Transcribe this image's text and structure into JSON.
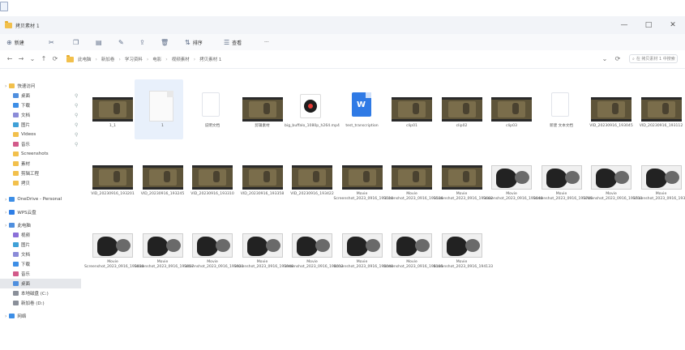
{
  "window": {
    "tab_title": "拷贝素材 1",
    "controls": [
      "—",
      "□",
      "✕"
    ]
  },
  "toolbar": {
    "new_label": "新建",
    "sort_label": "排序",
    "view_label": "查看",
    "more": "···"
  },
  "address": {
    "crumbs": [
      "此电脑",
      "新加卷",
      "学习资料",
      "电影",
      "视频素材",
      "拷贝素材 1"
    ],
    "search_placeholder": "在 拷贝素材 1 中搜索"
  },
  "sidebar": {
    "items": [
      {
        "label": "快速访问",
        "color": "#f2c04c",
        "indent": 6
      },
      {
        "label": "桌面",
        "color": "#4f8fde",
        "indent": 16
      },
      {
        "label": "下载",
        "color": "#3d8ee6",
        "indent": 16
      },
      {
        "label": "文档",
        "color": "#8b8bd8",
        "indent": 16
      },
      {
        "label": "图片",
        "color": "#3fa0d7",
        "indent": 16
      },
      {
        "label": "Videos",
        "color": "#f2c04c",
        "indent": 16
      },
      {
        "label": "音乐",
        "color": "#d25a8a",
        "indent": 16
      },
      {
        "label": "Screenshots",
        "color": "#f2c04c",
        "indent": 16
      },
      {
        "label": "素材",
        "color": "#f2c04c",
        "indent": 16
      },
      {
        "label": "剪辑工程",
        "color": "#f2c04c",
        "indent": 16
      },
      {
        "label": "拷贝",
        "color": "#f2c04c",
        "indent": 16
      },
      {
        "label": "OneDrive - Personal",
        "color": "#3d8ee6",
        "indent": 6
      },
      {
        "label": "WPS云盘",
        "color": "#2e7ee6",
        "indent": 6
      },
      {
        "label": "此电脑",
        "color": "#4f8fde",
        "indent": 6
      },
      {
        "label": "视频",
        "color": "#8b6fd8",
        "indent": 16
      },
      {
        "label": "图片",
        "color": "#3fa0d7",
        "indent": 16
      },
      {
        "label": "文档",
        "color": "#8b8bd8",
        "indent": 16
      },
      {
        "label": "下载",
        "color": "#3d8ee6",
        "indent": 16
      },
      {
        "label": "音乐",
        "color": "#d25a8a",
        "indent": 16
      },
      {
        "label": "桌面",
        "color": "#4f8fde",
        "indent": 16
      },
      {
        "label": "本地磁盘 (C:)",
        "color": "#8a8f99",
        "indent": 16
      },
      {
        "label": "新加卷 (D:)",
        "color": "#8a8f99",
        "indent": 16
      },
      {
        "label": "网络",
        "color": "#3d8ee6",
        "indent": 6
      }
    ]
  },
  "files": [
    {
      "name": "1_1",
      "type": "film"
    },
    {
      "name": "1",
      "type": "doc",
      "selected": true
    },
    {
      "name": "说明文档",
      "type": "blank"
    },
    {
      "name": "剪辑素材",
      "type": "film"
    },
    {
      "name": "big_buffalo_1080p_h264.mp4",
      "type": "media"
    },
    {
      "name": "test_transcription",
      "type": "word"
    },
    {
      "name": "clip01",
      "type": "film"
    },
    {
      "name": "clip02",
      "type": "film"
    },
    {
      "name": "clip03",
      "type": "film"
    },
    {
      "name": "新建 文本文档",
      "type": "blank"
    },
    {
      "name": "VID_20230916_193045",
      "type": "film"
    },
    {
      "name": "VID_20230916_193112",
      "type": "film"
    },
    {
      "name": "VID_20230916_193201",
      "type": "film"
    },
    {
      "name": "VID_20230916_193245",
      "type": "film"
    },
    {
      "name": "VID_20230916_193310",
      "type": "film"
    },
    {
      "name": "VID_20230916_193358",
      "type": "film"
    },
    {
      "name": "VID_20230916_193422",
      "type": "film"
    },
    {
      "name": "Movie Screenshot_2023_0916_193510",
      "type": "film"
    },
    {
      "name": "Movie Screenshot_2023_0916_193536",
      "type": "film"
    },
    {
      "name": "Movie Screenshot_2023_0916_193602",
      "type": "film"
    },
    {
      "name": "Movie Screenshot_2023_0916_193640",
      "type": "bw"
    },
    {
      "name": "Movie Screenshot_2023_0916_193705",
      "type": "bw"
    },
    {
      "name": "Movie Screenshot_2023_0916_193731",
      "type": "bw"
    },
    {
      "name": "Movie Screenshot_2023_0916_193802",
      "type": "bw"
    },
    {
      "name": "Movie Screenshot_2023_0916_193830",
      "type": "bw"
    },
    {
      "name": "Movie Screenshot_2023_0916_193857",
      "type": "bw"
    },
    {
      "name": "Movie Screenshot_2023_0916_193921",
      "type": "bw"
    },
    {
      "name": "Movie Screenshot_2023_0916_193948",
      "type": "bw"
    },
    {
      "name": "Movie Screenshot_2023_0916_194012",
      "type": "bw"
    },
    {
      "name": "Movie Screenshot_2023_0916_194040",
      "type": "bw"
    },
    {
      "name": "Movie Screenshot_2023_0916_194105",
      "type": "bw"
    },
    {
      "name": "Movie Screenshot_2023_0916_194133",
      "type": "bw"
    }
  ]
}
